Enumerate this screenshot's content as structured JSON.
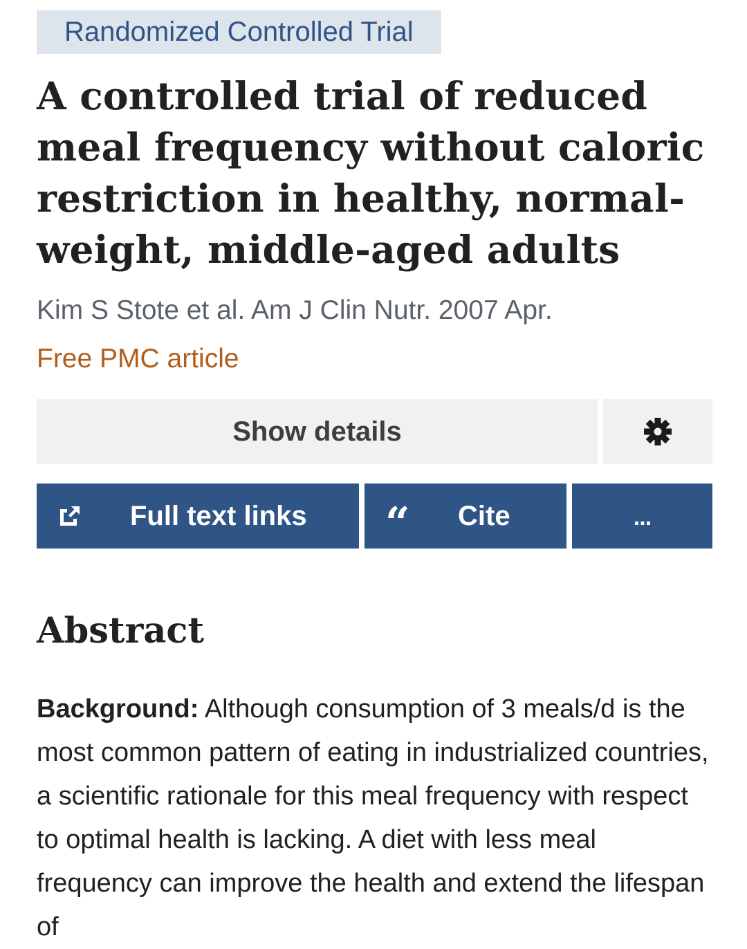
{
  "article": {
    "type_badge": "Randomized Controlled Trial",
    "title": "A controlled trial of reduced meal frequency without caloric restriction in healthy, normal-weight, middle-aged adults",
    "citation": "Kim S Stote et al. Am J Clin Nutr. 2007 Apr.",
    "free_pmc": "Free PMC article"
  },
  "actions": {
    "show_details_label": "Show details",
    "settings_icon": "gear-icon",
    "full_text_label": "Full text links",
    "full_text_icon": "external-link-icon",
    "cite_label": "Cite",
    "cite_icon": "quote-icon",
    "more_label": "..."
  },
  "abstract": {
    "heading": "Abstract",
    "background_label": "Background:",
    "background_text": "Although consumption of 3 meals/d is the most common pattern of eating in industrialized countries, a scientific rationale for this meal frequency with respect to optimal health is lacking. A diet with less meal frequency can improve the health and extend the lifespan of"
  },
  "colors": {
    "accent_blue": "#2f5587",
    "badge_bg": "#dde4ec",
    "pmc_link": "#b15e1c",
    "gray_button": "#f1f1f1"
  }
}
